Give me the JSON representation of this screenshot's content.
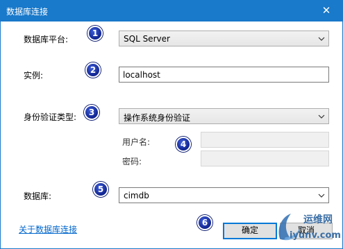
{
  "window": {
    "title": "数据库连接",
    "close_glyph": "✕"
  },
  "platform": {
    "label": "数据库平台:",
    "value": "SQL Server",
    "badge": "1"
  },
  "instance": {
    "label": "实例:",
    "value": "localhost",
    "badge": "2"
  },
  "auth": {
    "label": "身份验证类型:",
    "value": "操作系统身份验证",
    "badge": "3"
  },
  "credentials": {
    "username_label": "用户名:",
    "password_label": "密码:",
    "username_value": "",
    "password_value": "",
    "badge": "4"
  },
  "database": {
    "label": "数据库:",
    "value": "cimdb",
    "badge": "5"
  },
  "footer": {
    "about_link": "关于数据库连接",
    "ok_label": "确定",
    "cancel_label": "取消",
    "badge": "6"
  },
  "watermark": {
    "cn": "运维网",
    "en": "iyunv.com"
  },
  "colors": {
    "titlebar": "#1979ca",
    "link": "#0066cc",
    "badge": "#1a2fa8",
    "default_button_border": "#0078d7"
  }
}
